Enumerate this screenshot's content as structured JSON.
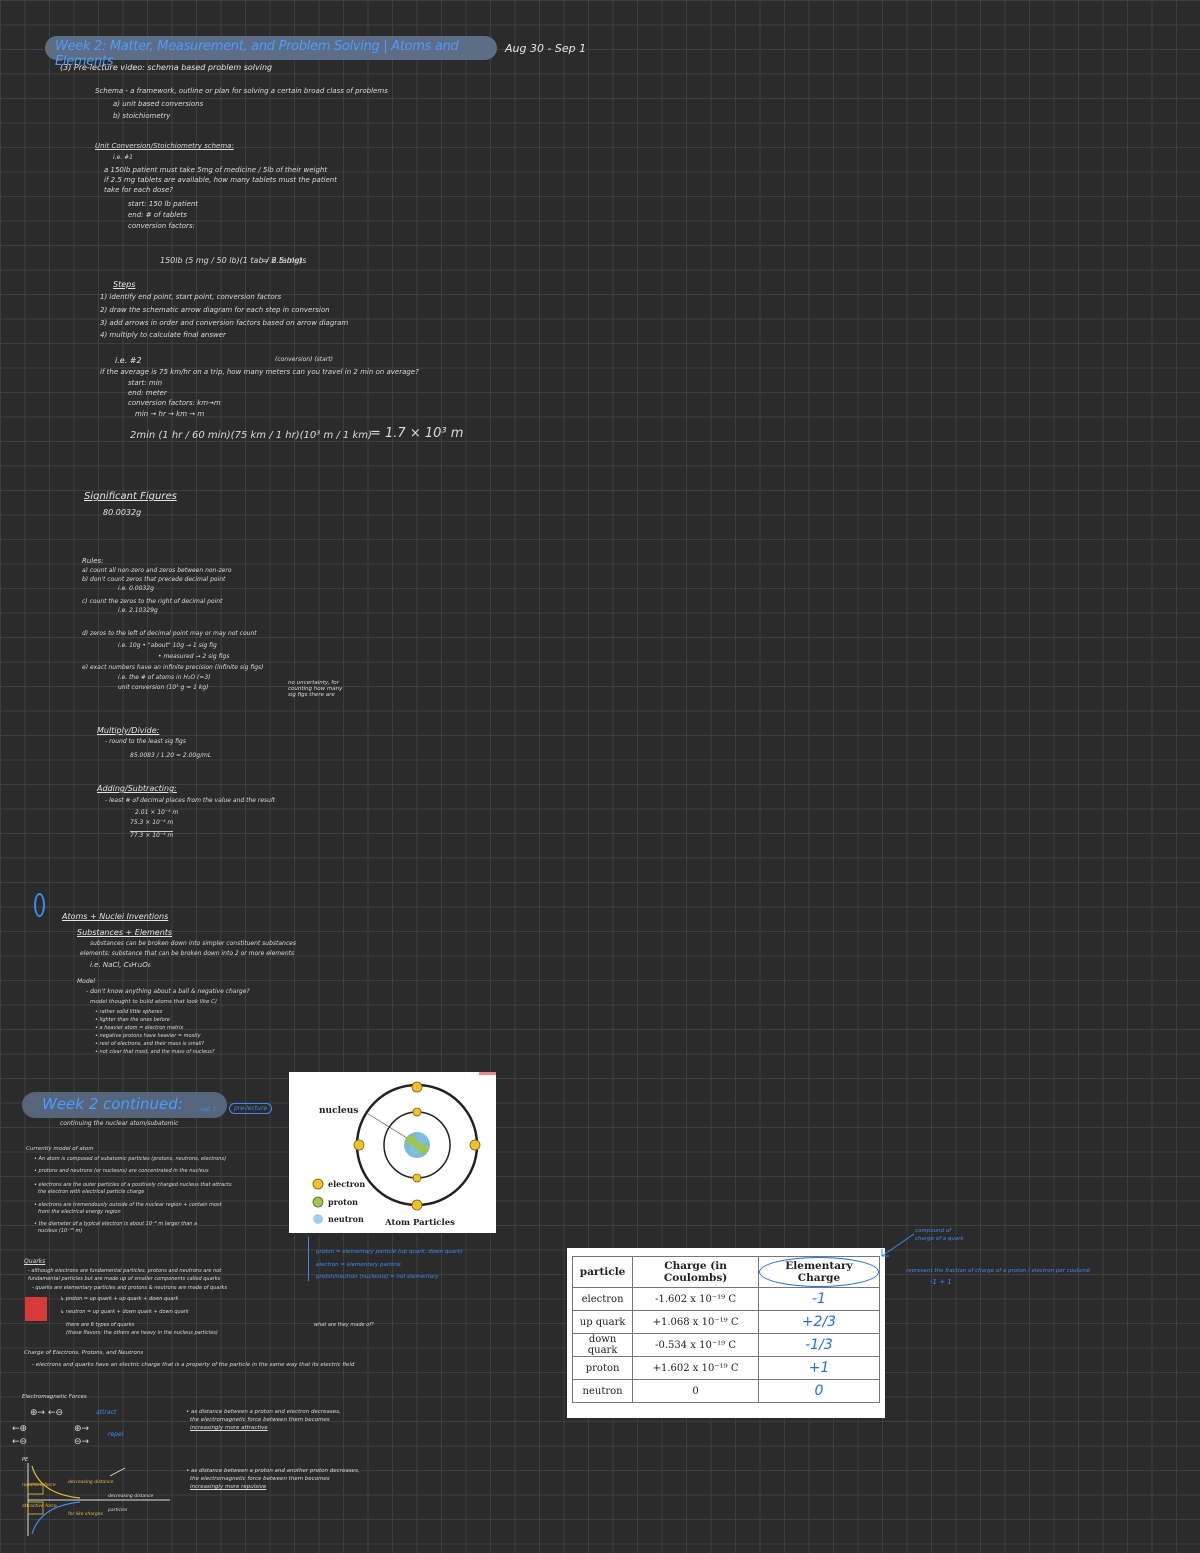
{
  "header": {
    "title": "Week 2: Matter, Measurement, and Problem Solving | Atoms and Elements",
    "date": "Aug 30 - Sep 1"
  },
  "section1": {
    "video_line": "(3) Pre-lecture video: schema based problem solving",
    "schema_def": "Schema - a framework, outline or plan for solving a certain broad class of problems",
    "schema_a": "a) unit based conversions",
    "schema_b": "b) stoichiometry",
    "unit_conv_title": "Unit Conversion/Stoichiometry schema:",
    "ex1_label": "i.e. #1",
    "ex1_q1": "a 150lb patient must take 5mg of medicine / 5lb of their weight",
    "ex1_q2": "if 2.5 mg tablets are available, how many tablets must the patient",
    "ex1_q3": "take for each dose?",
    "start": "start: 150 lb patient",
    "end": "end: # of tablets",
    "conv_factors": "conversion factors:",
    "eq_left": "150lb (5 mg / 50 lb)(1 tab / 2.5 mg)",
    "eq_right": "= 6 tablets",
    "steps_title": "Steps",
    "step1": "1) identify end point, start point, conversion factors",
    "step2": "2) draw the schematic arrow diagram for each step in conversion",
    "step3": "3) add arrows in order and conversion factors based on arrow diagram",
    "step4": "4) multiply to calculate final answer",
    "ex2_label": "i.e. #2",
    "ex2_tags": "(conversion)          (start)",
    "ex2_q": "if the average is 75 km/hr on a trip, how many meters can you travel in 2 min on average?",
    "ex2_start": "start: min",
    "ex2_end": "end: meter",
    "ex2_conv": "conversion factors: km→m",
    "ex2_chain": "min → hr → km → m",
    "ex2_eq": "2min (1 hr / 60 min)(75 km / 1 hr)(10³ m / 1 km)",
    "ex2_ans": "= 1.7 × 10³ m"
  },
  "sigfigs": {
    "title": "Significant Figures",
    "example": "80.0032g",
    "rules": "Rules:",
    "r1": "a) count all non-zero and zeros between non-zero",
    "r1b": "b) don't count zeros that precede decimal point",
    "r1c": "i.e. 0.0032g",
    "r2": "c) count the zeros to the right of decimal point",
    "r2b": "i.e. 2.10329g",
    "r3": "d) zeros to the left of decimal point may or may not count",
    "r3a": "i.e. 10g   • \"about\" 10g → 1 sig fig",
    "r3b": "• measured → 2 sig figs",
    "r4": "e) exact numbers have an infinite precision (infinite sig figs)",
    "r4a": "i.e. the # of atoms in H₂O (=3)",
    "r4b": "unit conversion (10³ g = 1 kg)",
    "r4note": "no uncertainty, for counting how many sig figs there are",
    "mult_title": "Multiply/Divide:",
    "mult_rule": "- round to the least sig figs",
    "mult_eq": "85.0083 / 1.20 = 2.00g/mL",
    "add_title": "Adding/Subtracting:",
    "add_rule": "- least # of decimal places from the value and the result",
    "add_1": "2.01 × 10⁻⁴ m",
    "add_2": "75.3 × 10⁻⁴ m",
    "add_3": "77.3 × 10⁻⁴ m"
  },
  "atoms": {
    "title": "Atoms + Nuclei Inventions",
    "subs_title": "Substances + Elements",
    "subs_1": "substances can be broken down into simpler constituent substances",
    "subs_2": "elements: substance that can be broken down into 2 or more elements",
    "subs_3": "i.e. NaCl, C₆H₁₂O₆",
    "model_title": "Model",
    "model_1": "- don't know anything about a ball & negative charge?",
    "model_2": "model thought to build atoms that look like C/",
    "model_b1": "• rather solid little spheres",
    "model_b2": "• lighter than the ones before",
    "model_b3": "• a heavier atom = electron matrix",
    "model_b4": "• negative protons have heavier = mostly",
    "model_b5": "• rest of electrons, and their mass is small?",
    "model_b6": "• not clear that most, and the mass of nucleus?"
  },
  "week2c": {
    "title": "Week 2 continued:",
    "tag1": "sep 1",
    "tag2": "pre-lecture",
    "sub": "continuing the nuclear atom/subatomic",
    "model_title": "Currently model of atom",
    "m1": "• An atom is composed of subatomic particles (protons, neutrons, electrons)",
    "m2": "• protons and neutrons (or nucleons) are concentrated in the nucleus",
    "m3": "• electrons are the outer particles of a positively charged nucleus that attracts",
    "m3b": "the electron with electrical particle charge",
    "m4": "• electrons are tremendously outside of the nuclear region + contain most",
    "m4b": "from the electrical energy region",
    "m5": "• the diameter of a typical electron is about 10⁻⁸ m larger than a",
    "m5b": "nucleus (10⁻¹⁵ m)",
    "quarks_title": "Quarks",
    "q1": "- although electrons are fundamental particles, protons and neutrons are not",
    "q1b": "fundamental particles but are made up of smaller components called quarks",
    "q2": "- quarks are elementary particles and protons & neutrons are made of quarks",
    "q3": "↳ proton = up quark + up quark + down quark",
    "q4": "↳ neutron = up quark + down quark + down quark",
    "q5": "there are 6 types of quarks",
    "q6": "(these flavors: the others are heavy in the nucleus particles)",
    "q_note": "what are they made of?",
    "charge_title": "Charge of Electrons, Protons, and Neutrons",
    "charge_1": "- electrons and quarks have an electric charge that is a property of the particle in the same way that its electric field",
    "elec_title": "Electromagnetic Forces",
    "like": "repel",
    "unlike": "attract",
    "f1": "• as distance between a proton and electron decreases,",
    "f1b": "the electromagnetic force between them becomes",
    "f1c": "increasingly more attractive",
    "f2": "• as distance between a proton and another proton decreases,",
    "f2b": "the electromagnetic force between them becomes",
    "f2c": "increasingly more repulsive",
    "axis": "PE",
    "graph_lbl1": "repulsive force",
    "graph_lbl2": "attractive force",
    "graph_lbl3": "decreasing distance",
    "graph_lbl4": "for like charges",
    "graph_lbl5": "decreasing distance",
    "graph_lbl6": "particles",
    "elem_note1": "proton = elementary particle (up quark, down quark)",
    "elem_note2": "electron = elementary particle",
    "elem_note3": "proton/neutron (nucleons) = not elementary",
    "right_note1": "compound of",
    "right_note2": "charge of a quark",
    "right_note3": "represent the fraction of charge of a proton / electron per coulomb",
    "right_note4": "-1     + 1"
  },
  "atom_fig": {
    "nucleus": "nucleus",
    "electron": "electron",
    "proton": "proton",
    "neutron": "neutron",
    "caption": "Atom Particles"
  },
  "table": {
    "headers": [
      "particle",
      "Charge (in Coulombs)",
      "Elementary Charge"
    ],
    "rows": [
      [
        "electron",
        "-1.602 x 10⁻¹⁹ C",
        "-1"
      ],
      [
        "up quark",
        "+1.068 x 10⁻¹⁹ C",
        "+2/3"
      ],
      [
        "down quark",
        "-0.534 x 10⁻¹⁹ C",
        "-1/3"
      ],
      [
        "proton",
        "+1.602 x 10⁻¹⁹ C",
        "+1"
      ],
      [
        "neutron",
        "0",
        "0"
      ]
    ]
  }
}
